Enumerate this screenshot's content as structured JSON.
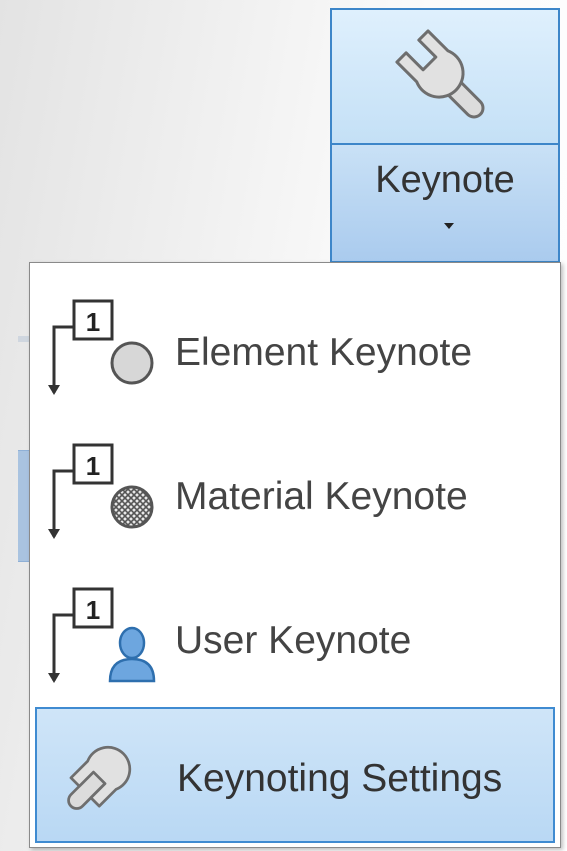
{
  "ribbon": {
    "button_label": "Keynote",
    "icon": "wrench-icon"
  },
  "dropdown": {
    "items": [
      {
        "label": "Element Keynote",
        "icon": "element-keynote-icon"
      },
      {
        "label": "Material Keynote",
        "icon": "material-keynote-icon"
      },
      {
        "label": "User Keynote",
        "icon": "user-keynote-icon"
      },
      {
        "label": "Keynoting Settings",
        "icon": "wrench-icon",
        "highlighted": true
      }
    ],
    "tag_number": "1"
  },
  "colors": {
    "accent_border": "#3d86c9",
    "highlight_bg": "#c4dff6"
  }
}
